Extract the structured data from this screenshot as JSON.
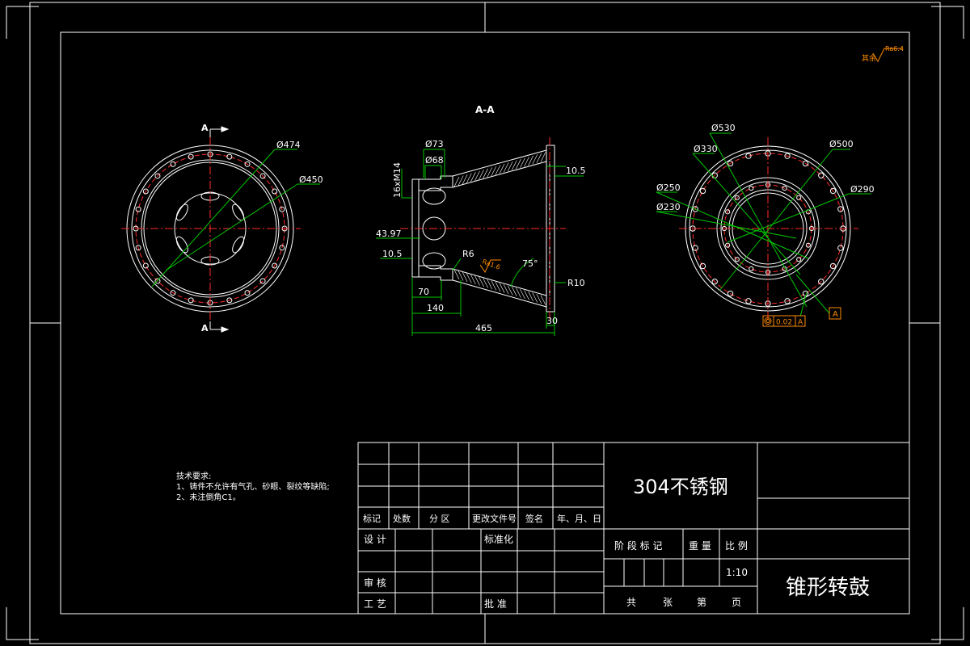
{
  "colors": {
    "background": "#000000",
    "outline": "#ffffff",
    "center_line": "#ff2a2a",
    "dimension": "#00c800",
    "annotation": "#ff8c00"
  },
  "surface_finish": {
    "prefix": "其余",
    "value": "Ra6.4"
  },
  "views": {
    "section_label": "A-A",
    "cut_label_top": "A",
    "cut_label_bottom": "A"
  },
  "left_view": {
    "dim_outer": "Ø474",
    "dim_pitch": "Ø450"
  },
  "section_view": {
    "dim_d73": "Ø73",
    "dim_d68": "Ø68",
    "dim_thread": "16xM14",
    "dim_43_97": "43.97",
    "dim_10_5_left": "10.5",
    "dim_10_5_right": "10.5",
    "dim_r6": "R6",
    "dim_ra": "Ra1.6",
    "dim_angle": "75°",
    "dim_r10": "R10",
    "dim_70": "70",
    "dim_140": "140",
    "dim_465": "465",
    "dim_30": "30"
  },
  "right_view": {
    "dim_530": "Ø530",
    "dim_330": "Ø330",
    "dim_500": "Ø500",
    "dim_250": "Ø250",
    "dim_290": "Ø290",
    "dim_230": "Ø230",
    "datum": "A",
    "tolerance_value": "0.02",
    "tolerance_datum": "A"
  },
  "tech_requirements": {
    "title": "技术要求:",
    "line1": "1、铸件不允许有气孔、砂眼、裂纹等缺陷;",
    "line2": "2、未注倒角C1。"
  },
  "title_block": {
    "material": "304不锈钢",
    "part_name": "锥形转鼓",
    "rev_headers": [
      "标记",
      "处数",
      "分 区",
      "更改文件号",
      "签名",
      "年、月、日"
    ],
    "design": "设 计",
    "standardize": "标准化",
    "review": "审 核",
    "process": "工 艺",
    "approve": "批 准",
    "stage_mark": "阶 段 标 记",
    "weight": "重 量",
    "scale_label": "比 例",
    "scale_value": "1:10",
    "total": "共",
    "sheets": "张",
    "sheet_no": "第",
    "page": "页"
  }
}
